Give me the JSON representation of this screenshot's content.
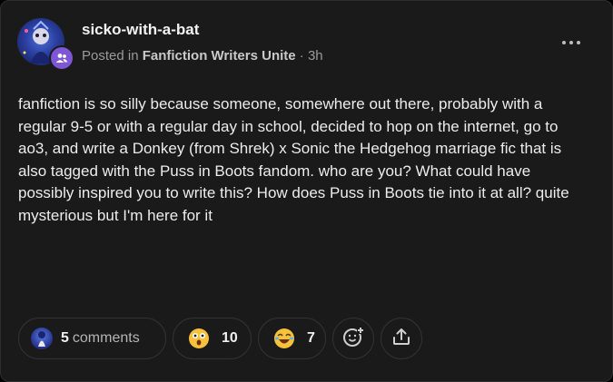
{
  "post": {
    "username": "sicko-with-a-bat",
    "posted_in_prefix": "Posted in",
    "community": "Fanfiction Writers Unite",
    "separator": "·",
    "time": "3h",
    "body": "fanfiction is so silly because someone, somewhere out there, probably with a regular 9-5 or with a regular day in school, decided to hop on the internet, go to ao3, and write a Donkey (from Shrek) x Sonic the Hedgehog marriage fic that is also tagged with the Puss in Boots fandom. who are you? What could have possibly inspired you to write this? How does Puss in Boots tie into it at all? quite mysterious but I'm here for it"
  },
  "actions": {
    "comments_count": "5",
    "comments_label": "comments",
    "reactions": [
      {
        "icon": "astonished-emoji-icon",
        "count": "10"
      },
      {
        "icon": "laughing-emoji-icon",
        "count": "7"
      }
    ],
    "add_reaction_icon": "add-reaction-icon",
    "share_icon": "share-icon"
  },
  "colors": {
    "card_background": "#1a1a1a",
    "border": "#333333",
    "community_badge": "#7d57d6",
    "text_primary": "#ececec",
    "text_secondary": "#9a9a9a"
  }
}
